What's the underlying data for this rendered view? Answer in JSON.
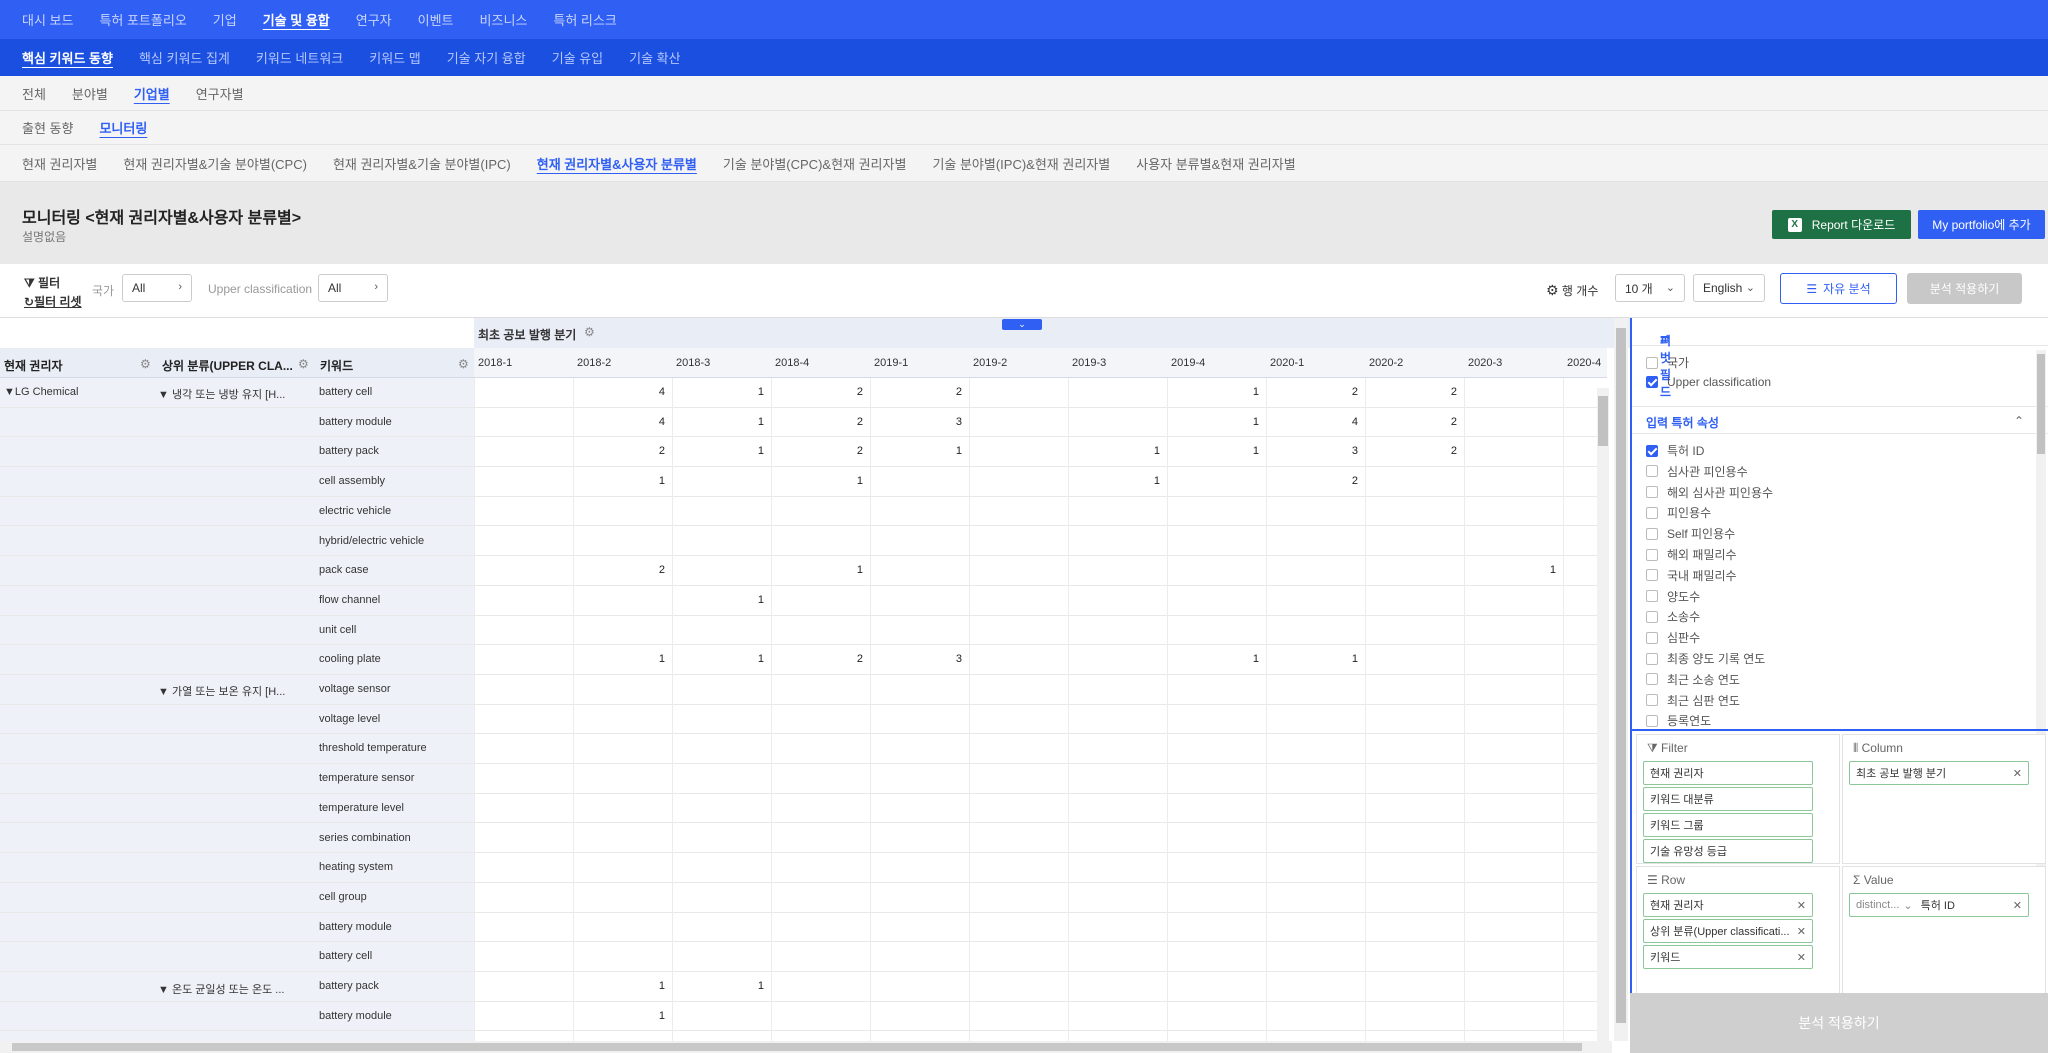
{
  "nav": {
    "primary": [
      "대시 보드",
      "특허 포트폴리오",
      "기업",
      "기술 및 융합",
      "연구자",
      "이벤트",
      "비즈니스",
      "특허 리스크"
    ],
    "secondary": [
      "핵심 키워드 동향",
      "핵심 키워드 집계",
      "키워드 네트워크",
      "키워드 맵",
      "기술 자기 융합",
      "기술 유입",
      "기술 확산"
    ],
    "tabs1": [
      "전체",
      "분야별",
      "기업별",
      "연구자별"
    ],
    "tabs2": [
      "출현 동향",
      "모니터링"
    ],
    "tabs3": [
      "현재 권리자별",
      "현재 권리자별&기술 분야별(CPC)",
      "현재 권리자별&기술 분야별(IPC)",
      "현재 권리자별&사용자 분류별",
      "기술 분야별(CPC)&현재 권리자별",
      "기술 분야별(IPC)&현재 권리자별",
      "사용자 분류별&현재 권리자별"
    ]
  },
  "header": {
    "title": "모니터링 <현재 권리자별&사용자 분류별>",
    "description": "설명없음",
    "report_button": "Report 다운로드",
    "portfolio_button": "My portfolio에 추가"
  },
  "filter": {
    "filter_label": "필터",
    "reset_label": "필터 리셋",
    "country_label": "국가",
    "country_value": "All",
    "upper_label": "Upper classification",
    "upper_value": "All",
    "rowcount_label": "행 개수",
    "rowcount_value": "10 개",
    "language_value": "English",
    "free_analysis": "자유 분석",
    "apply": "분석 적용하기"
  },
  "table": {
    "column_group": "최초 공보 발행 분기",
    "row_headers": [
      "현재 권리자",
      "상위 분류(UPPER CLA...",
      "키워드"
    ],
    "years": [
      "2018-1",
      "2018-2",
      "2018-3",
      "2018-4",
      "2019-1",
      "2019-2",
      "2019-3",
      "2019-4",
      "2020-1",
      "2020-2",
      "2020-3",
      "2020-4"
    ],
    "owner": "LG Chemical",
    "classes": [
      "냉각 또는 냉방 유지 [H...",
      "가열 또는 보온 유지 [H...",
      "온도 균일성 또는 온도 ..."
    ],
    "rows": [
      {
        "kw": "battery cell",
        "v": [
          "",
          "4",
          "1",
          "2",
          "2",
          "",
          "",
          "1",
          "2",
          "2",
          "",
          ""
        ]
      },
      {
        "kw": "battery module",
        "v": [
          "",
          "4",
          "1",
          "2",
          "3",
          "",
          "",
          "1",
          "4",
          "2",
          "",
          ""
        ]
      },
      {
        "kw": "battery pack",
        "v": [
          "",
          "2",
          "1",
          "2",
          "1",
          "",
          "1",
          "1",
          "3",
          "2",
          "",
          ""
        ]
      },
      {
        "kw": "cell assembly",
        "v": [
          "",
          "1",
          "",
          "1",
          "",
          "",
          "1",
          "",
          "2",
          "",
          "",
          ""
        ]
      },
      {
        "kw": "electric vehicle",
        "v": [
          "",
          "",
          "",
          "",
          "",
          "",
          "",
          "",
          "",
          "",
          "",
          ""
        ]
      },
      {
        "kw": "hybrid/electric vehicle",
        "v": [
          "",
          "",
          "",
          "",
          "",
          "",
          "",
          "",
          "",
          "",
          "",
          ""
        ]
      },
      {
        "kw": "pack case",
        "v": [
          "",
          "2",
          "",
          "1",
          "",
          "",
          "",
          "",
          "",
          "",
          "1",
          ""
        ]
      },
      {
        "kw": "flow channel",
        "v": [
          "",
          "",
          "1",
          "",
          "",
          "",
          "",
          "",
          "",
          "",
          "",
          ""
        ]
      },
      {
        "kw": "unit cell",
        "v": [
          "",
          "",
          "",
          "",
          "",
          "",
          "",
          "",
          "",
          "",
          "",
          ""
        ]
      },
      {
        "kw": "cooling plate",
        "v": [
          "",
          "1",
          "1",
          "2",
          "3",
          "",
          "",
          "1",
          "1",
          "",
          "",
          ""
        ]
      },
      {
        "kw": "voltage sensor",
        "v": [
          "",
          "",
          "",
          "",
          "",
          "",
          "",
          "",
          "",
          "",
          "",
          ""
        ]
      },
      {
        "kw": "voltage level",
        "v": [
          "",
          "",
          "",
          "",
          "",
          "",
          "",
          "",
          "",
          "",
          "",
          ""
        ]
      },
      {
        "kw": "threshold temperature",
        "v": [
          "",
          "",
          "",
          "",
          "",
          "",
          "",
          "",
          "",
          "",
          "",
          ""
        ]
      },
      {
        "kw": "temperature sensor",
        "v": [
          "",
          "",
          "",
          "",
          "",
          "",
          "",
          "",
          "",
          "",
          "",
          ""
        ]
      },
      {
        "kw": "temperature level",
        "v": [
          "",
          "",
          "",
          "",
          "",
          "",
          "",
          "",
          "",
          "",
          "",
          ""
        ]
      },
      {
        "kw": "series combination",
        "v": [
          "",
          "",
          "",
          "",
          "",
          "",
          "",
          "",
          "",
          "",
          "",
          ""
        ]
      },
      {
        "kw": "heating system",
        "v": [
          "",
          "",
          "",
          "",
          "",
          "",
          "",
          "",
          "",
          "",
          "",
          ""
        ]
      },
      {
        "kw": "cell group",
        "v": [
          "",
          "",
          "",
          "",
          "",
          "",
          "",
          "",
          "",
          "",
          "",
          ""
        ]
      },
      {
        "kw": "battery module",
        "v": [
          "",
          "",
          "",
          "",
          "",
          "",
          "",
          "",
          "",
          "",
          "",
          ""
        ]
      },
      {
        "kw": "battery cell",
        "v": [
          "",
          "",
          "",
          "",
          "",
          "",
          "",
          "",
          "",
          "",
          "",
          ""
        ]
      },
      {
        "kw": "battery pack",
        "v": [
          "",
          "1",
          "1",
          "",
          "",
          "",
          "",
          "",
          "",
          "",
          "",
          ""
        ]
      },
      {
        "kw": "battery module",
        "v": [
          "",
          "1",
          "",
          "",
          "",
          "",
          "",
          "",
          "",
          "",
          "",
          ""
        ]
      }
    ]
  },
  "panel": {
    "pivot_title": "피벗 필드",
    "pivot_fields": [
      {
        "label": "국가",
        "checked": false
      },
      {
        "label": "Upper classification",
        "checked": true
      }
    ],
    "attr_title": "입력 특허 속성",
    "attributes": [
      {
        "label": "특허 ID",
        "checked": true
      },
      {
        "label": "심사관 피인용수",
        "checked": false
      },
      {
        "label": "해외 심사관 피인용수",
        "checked": false
      },
      {
        "label": "피인용수",
        "checked": false
      },
      {
        "label": "Self 피인용수",
        "checked": false
      },
      {
        "label": "해외 패밀리수",
        "checked": false
      },
      {
        "label": "국내 패밀리수",
        "checked": false
      },
      {
        "label": "양도수",
        "checked": false
      },
      {
        "label": "소송수",
        "checked": false
      },
      {
        "label": "심판수",
        "checked": false
      },
      {
        "label": "최종 양도 기록 연도",
        "checked": false
      },
      {
        "label": "최근 소송 연도",
        "checked": false
      },
      {
        "label": "최근 심판 연도",
        "checked": false
      },
      {
        "label": "등록연도",
        "checked": false
      }
    ],
    "filter_zone": {
      "title": "Filter",
      "items": [
        "현재 권리자",
        "키워드 대분류",
        "키워드 그룹",
        "기술 유망성 등급"
      ]
    },
    "column_zone": {
      "title": "Column",
      "items": [
        "최초 공보 발행 분기"
      ]
    },
    "row_zone": {
      "title": "Row",
      "items": [
        "현재 권리자",
        "상위 분류(Upper classificati...",
        "키워드"
      ]
    },
    "value_zone": {
      "title": "Value",
      "agg": "distinct...",
      "field": "특허 ID"
    },
    "apply": "분석 적용하기"
  }
}
